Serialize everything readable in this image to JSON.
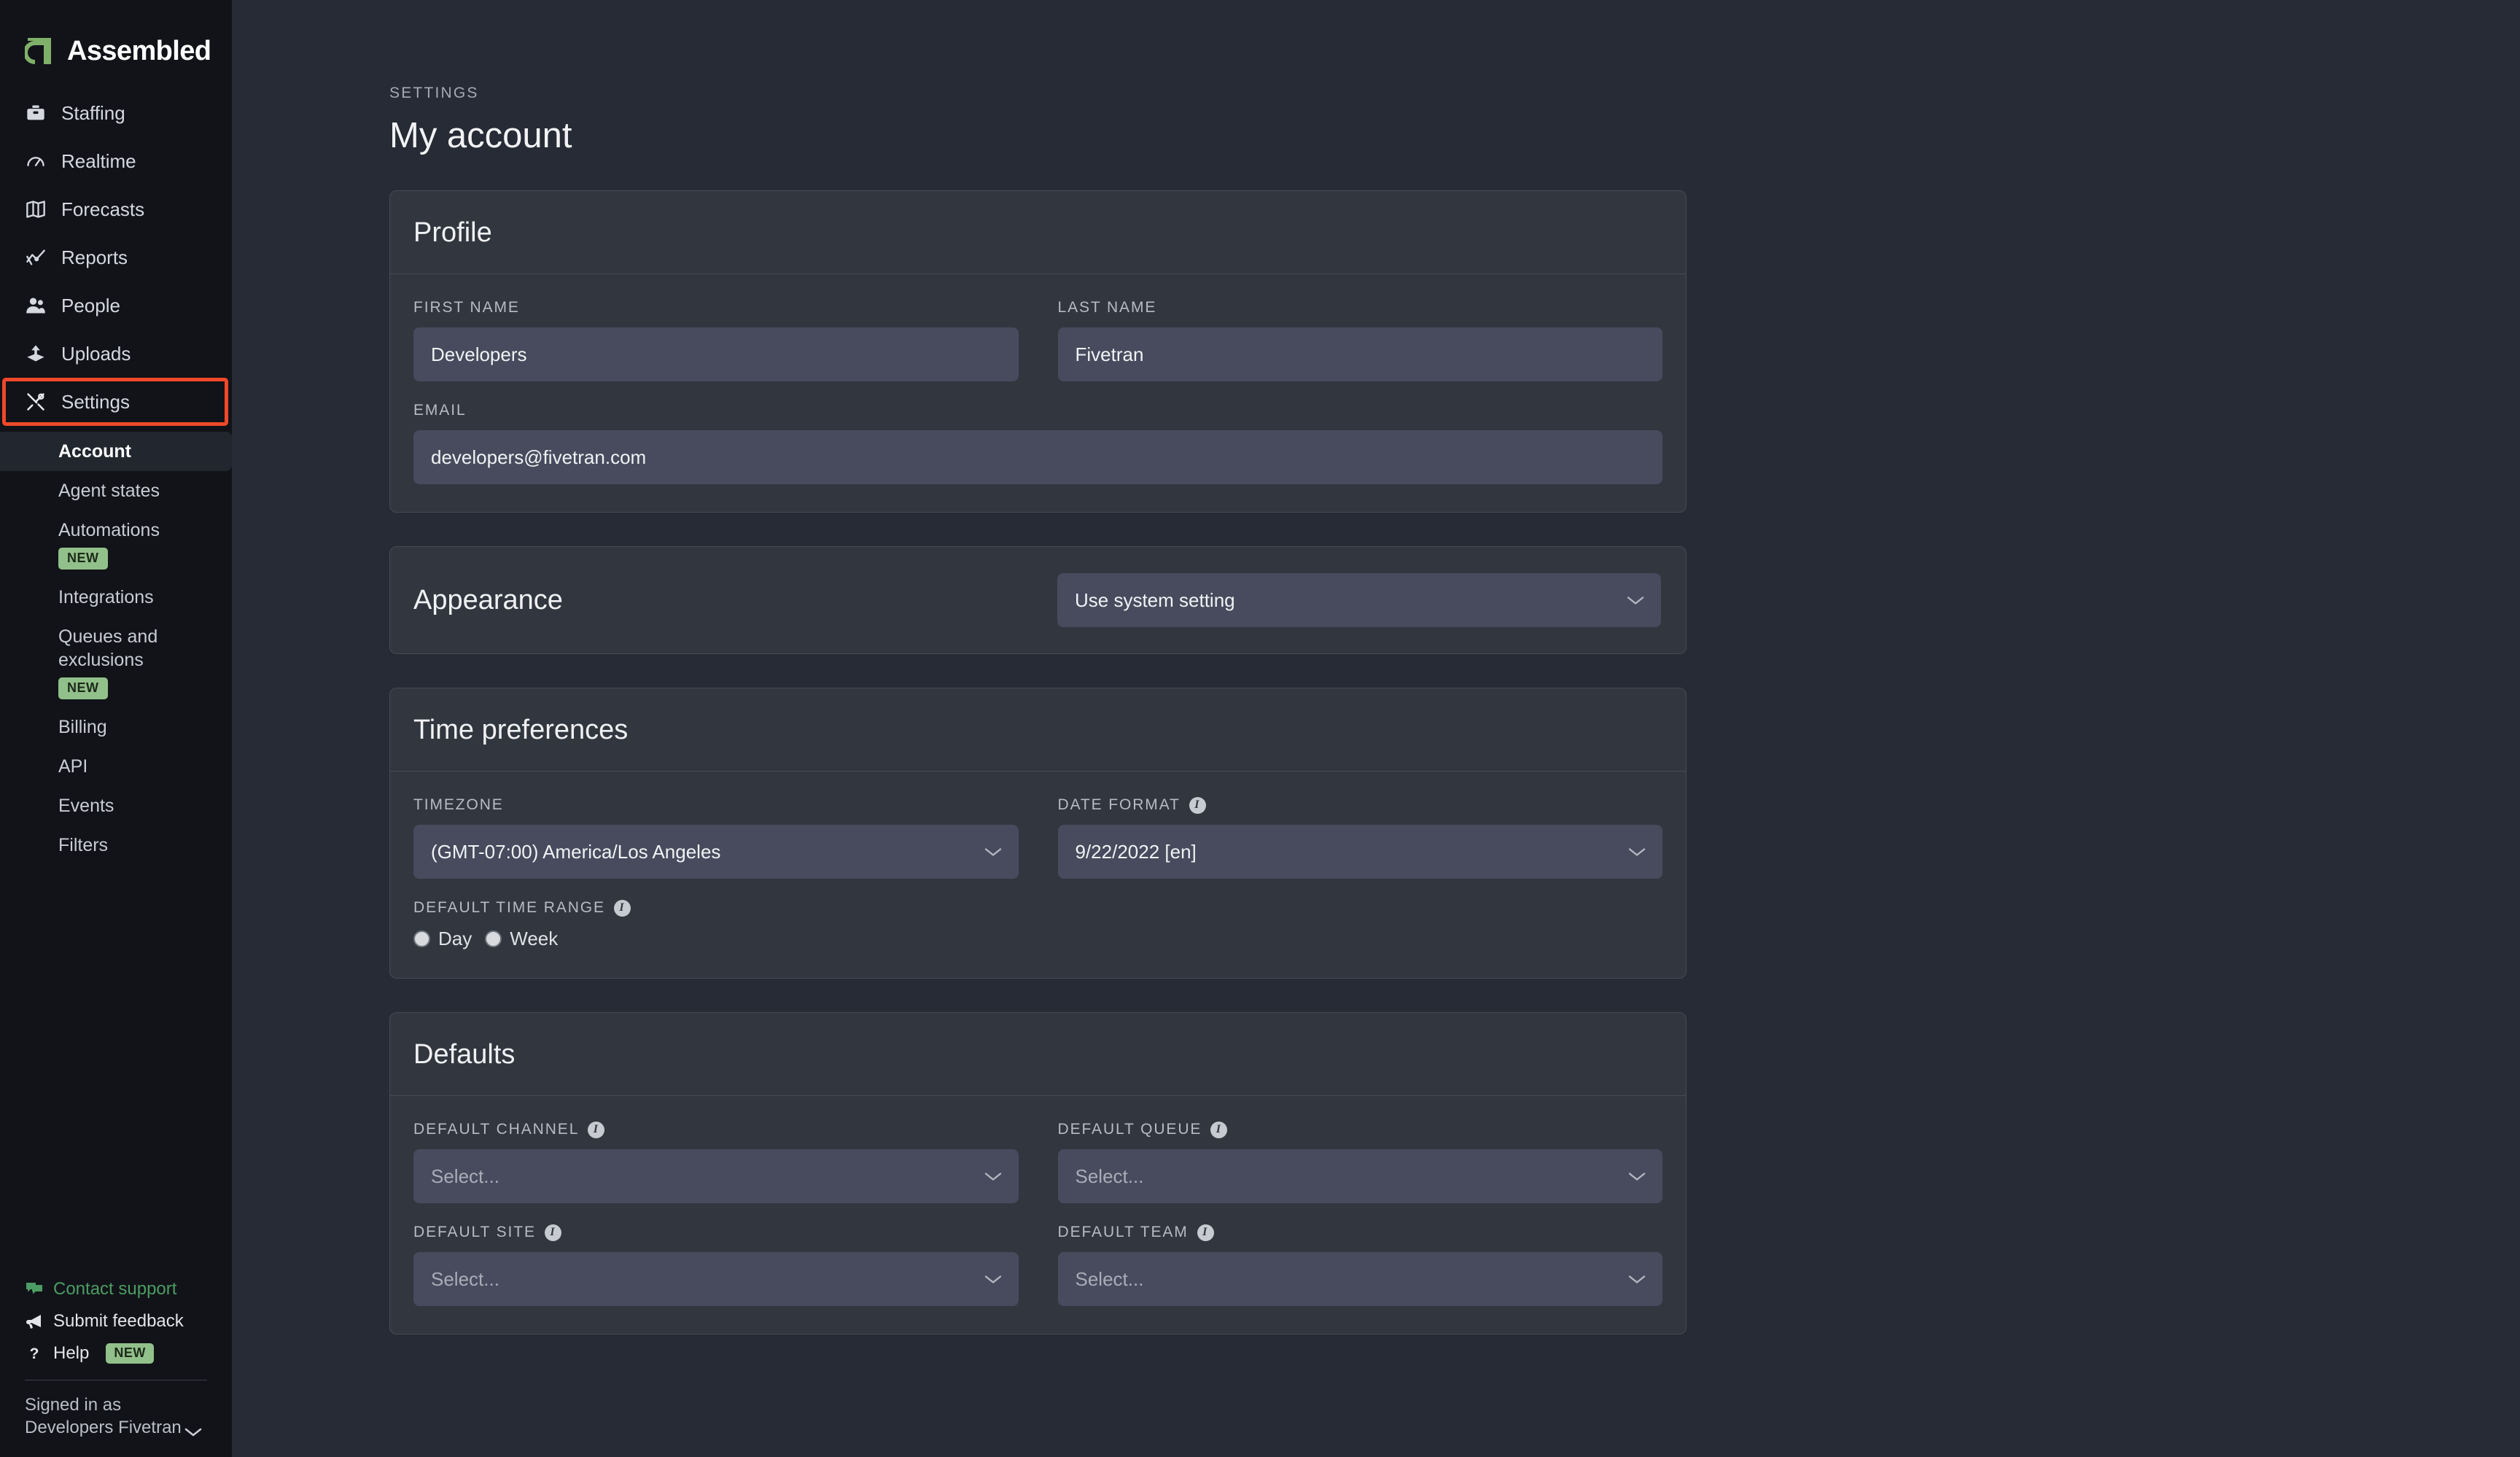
{
  "brand": {
    "name": "Assembled",
    "logo_icon": "assembled-logo-icon",
    "accent": "#7fb069"
  },
  "sidebar": {
    "nav": [
      {
        "label": "Staffing",
        "icon": "briefcase-icon"
      },
      {
        "label": "Realtime",
        "icon": "gauge-icon"
      },
      {
        "label": "Forecasts",
        "icon": "map-icon"
      },
      {
        "label": "Reports",
        "icon": "line-chart-icon"
      },
      {
        "label": "People",
        "icon": "users-icon"
      },
      {
        "label": "Uploads",
        "icon": "upload-icon"
      },
      {
        "label": "Settings",
        "icon": "tools-icon"
      }
    ],
    "subnav": [
      {
        "label": "Account",
        "badge": null
      },
      {
        "label": "Agent states",
        "badge": null
      },
      {
        "label": "Automations",
        "badge": "NEW"
      },
      {
        "label": "Integrations",
        "badge": null
      },
      {
        "label": "Queues and exclusions",
        "badge": "NEW"
      },
      {
        "label": "Billing",
        "badge": null
      },
      {
        "label": "API",
        "badge": null
      },
      {
        "label": "Events",
        "badge": null
      },
      {
        "label": "Filters",
        "badge": null
      }
    ],
    "footer": {
      "contact_support": "Contact support",
      "submit_feedback": "Submit feedback",
      "help": "Help",
      "help_badge": "NEW",
      "signed_in_label": "Signed in as",
      "signed_in_name": "Developers Fivetran"
    }
  },
  "page": {
    "eyebrow": "SETTINGS",
    "title": "My account"
  },
  "profile": {
    "title": "Profile",
    "first_name_label": "FIRST NAME",
    "first_name_value": "Developers",
    "last_name_label": "LAST NAME",
    "last_name_value": "Fivetran",
    "email_label": "EMAIL",
    "email_value": "developers@fivetran.com"
  },
  "appearance": {
    "title": "Appearance",
    "value": "Use system setting"
  },
  "time_preferences": {
    "title": "Time preferences",
    "timezone_label": "TIMEZONE",
    "timezone_value": "(GMT-07:00) America/Los Angeles",
    "date_format_label": "DATE FORMAT",
    "date_format_value": "9/22/2022 [en]",
    "default_time_range_label": "DEFAULT TIME RANGE",
    "options": [
      "Day",
      "Week"
    ]
  },
  "defaults": {
    "title": "Defaults",
    "channel_label": "DEFAULT CHANNEL",
    "channel_value": "Select...",
    "queue_label": "DEFAULT QUEUE",
    "queue_value": "Select...",
    "site_label": "DEFAULT SITE",
    "site_value": "Select...",
    "team_label": "DEFAULT TEAM",
    "team_value": "Select..."
  },
  "highlight": {
    "color": "#f0482a",
    "target": "Settings"
  }
}
